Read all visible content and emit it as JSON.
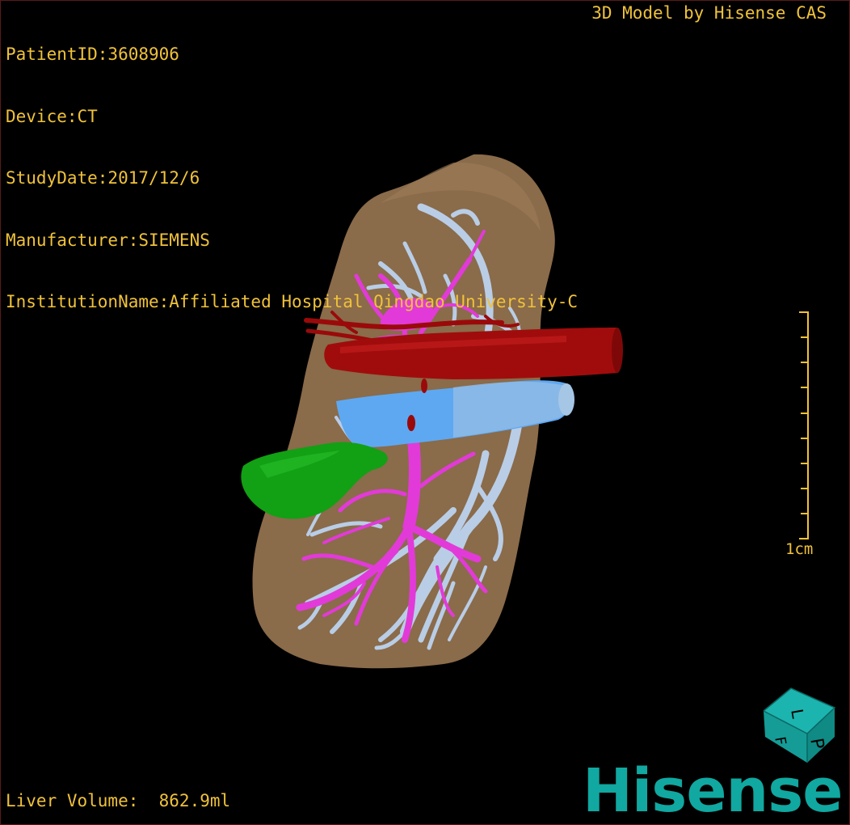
{
  "study": {
    "patient_id": "PatientID:3608906",
    "device": "Device:CT",
    "study_date": "StudyDate:2017/12/6",
    "manufacturer": "Manufacturer:SIEMENS",
    "institution": "InstitutionName:Affiliated Hospital Qingdao University-C"
  },
  "brand_caption": "3D Model by Hisense CAS",
  "liver_volume": "Liver Volume:  862.9ml",
  "scale_bar": {
    "label": "1cm",
    "color": "#f0c23a"
  },
  "orientation_cube": {
    "face_top": "L",
    "face_front": "P",
    "face_side": "F",
    "color": "#1aa4a0"
  },
  "logo_text": "Hisense",
  "colors": {
    "overlay_text": "#f0c23a",
    "liver": "#8c6d4b",
    "hepatic_vein": "#b8cce6",
    "portal_vein": "#e23ad8",
    "ivc": "#5fa8f2",
    "artery": "#9a0a0a",
    "gallbladder": "#0fa010",
    "logo": "#10a8a0"
  }
}
